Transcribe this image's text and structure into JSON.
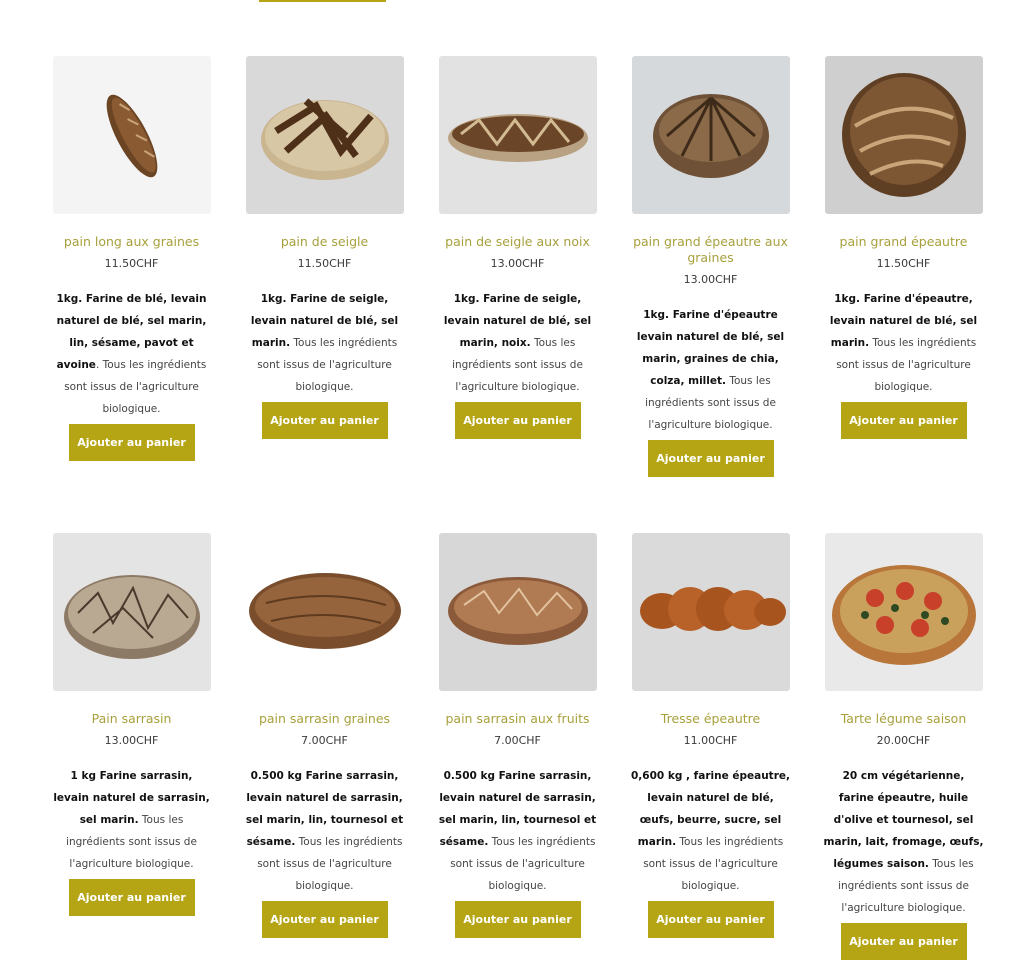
{
  "products": [
    {
      "name": "pain long aux graines",
      "price": "11.50CHF",
      "desc_bold": "1kg. Farine de blé, levain naturel de blé, sel marin, lin, sésame, pavot et avoine",
      "desc_rest": ". Tous les ingrédients sont issus de l'agriculture biologique.",
      "button": "Ajouter au panier",
      "icon": "bread-image"
    },
    {
      "name": "pain de seigle",
      "price": "11.50CHF",
      "desc_bold": "1kg.  Farine de seigle, levain naturel de blé, sel marin.",
      "desc_rest": " Tous les ingrédients sont issus de l'agriculture biologique.",
      "button": "Ajouter au panier",
      "icon": "bread-image"
    },
    {
      "name": "pain de seigle aux noix",
      "price": "13.00CHF",
      "desc_bold": "1kg. Farine de seigle, levain naturel de blé, sel marin, noix.",
      "desc_rest": " Tous les ingrédients sont issus de l'agriculture biologique.",
      "button": "Ajouter au panier",
      "icon": "bread-image"
    },
    {
      "name": "pain grand épeautre aux graines",
      "price": "13.00CHF",
      "desc_bold": "1kg. Farine d'épeautre levain naturel de blé, sel marin, graines de chia, colza, millet.",
      "desc_rest": " Tous les ingrédients sont issus de l'agriculture biologique.",
      "button": "Ajouter au panier",
      "icon": "bread-image"
    },
    {
      "name": "pain grand épeautre",
      "price": "11.50CHF",
      "desc_bold": "1kg. Farine d'épeautre, levain naturel de blé, sel marin.",
      "desc_rest": " Tous les ingrédients sont issus de l'agriculture biologique.",
      "button": "Ajouter au panier",
      "icon": "bread-image"
    },
    {
      "name": "Pain sarrasin",
      "price": "13.00CHF",
      "desc_bold": "1 kg  Farine sarrasin, levain naturel de sarrasin, sel marin.",
      "desc_rest": " Tous les ingrédients sont issus de l'agriculture biologique.",
      "button": "Ajouter au panier",
      "icon": "bread-image"
    },
    {
      "name": "pain sarrasin graines",
      "price": "7.00CHF",
      "desc_bold": "0.500 kg  Farine sarrasin, levain naturel de sarrasin, sel marin, lin, tournesol et sésame.",
      "desc_rest": " Tous les ingrédients sont issus de l'agriculture biologique.",
      "button": "Ajouter au panier",
      "icon": "bread-image"
    },
    {
      "name": "pain sarrasin aux fruits",
      "price": "7.00CHF",
      "desc_bold": "0.500 kg  Farine sarrasin, levain naturel de sarrasin, sel marin, lin, tournesol et sésame.",
      "desc_rest": " Tous les ingrédients sont issus de l'agriculture biologique.",
      "button": "Ajouter au panier",
      "icon": "bread-image"
    },
    {
      "name": "Tresse épeautre",
      "price": "11.00CHF",
      "desc_bold": "0,600 kg , farine épeautre, levain naturel de blé, œufs, beurre, sucre, sel marin.",
      "desc_rest": " Tous les ingrédients sont issus de l'agriculture biologique.",
      "button": "Ajouter au panier",
      "icon": "braided-bread-image"
    },
    {
      "name": "Tarte légume saison",
      "price": "20.00CHF",
      "desc_bold": "20 cm  végétarienne, farine épeautre, huile d'olive et tournesol, sel marin, lait, fromage, œufs, légumes saison.",
      "desc_rest": " Tous les ingrédients sont issus de l'agriculture biologique.",
      "button": "Ajouter au panier",
      "icon": "vegetable-tart-image"
    }
  ],
  "colors": {
    "accent": "#b5a514",
    "name": "#a7a03c",
    "text": "#3a3a3a"
  }
}
